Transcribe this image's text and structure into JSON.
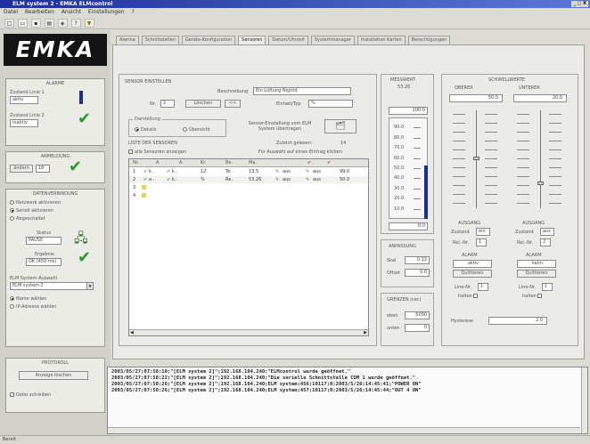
{
  "window": {
    "title": "ELM system 2 - EMKA ELMcontrol",
    "controls": "_ □ X"
  },
  "menu": [
    "Datei",
    "Bearbeiten",
    "Ansicht",
    "Einstellungen",
    "?"
  ],
  "logo": "EMKA",
  "alarme": {
    "title": "ALARME",
    "line1_label": "Zustand Linie 1",
    "line1_value": "aktiv",
    "line2_label": "Zustand Linie 2",
    "line2_value": "inaktiv"
  },
  "anmeldung": {
    "title": "ANMELDUNG",
    "button": "ändern",
    "value": "18"
  },
  "datenverbindung": {
    "title": "DATENVERBINDUNG",
    "options": [
      "Netzwerk aktivieren",
      "Seriell aktivieren",
      "Abgeschaltet"
    ],
    "status_label": "Status",
    "status_value": "PAUSE",
    "ergebnis_label": "Ergebnis",
    "ergebnis_value": "OK (450 ms)",
    "system_label": "ELM System-Auswahl",
    "system_value": "ELM system 2",
    "mode_options": [
      "Name wählen",
      "IP-Adresse wählen"
    ]
  },
  "protokoll": {
    "title": "PROTOKOLL",
    "button": "Anzeige löschen",
    "checkbox": "Datei schreiben"
  },
  "tabs": [
    "Alarme",
    "Schnittstellen",
    "Geräte-Konfiguration",
    "Sensoren",
    "Datum/Uhrzeit",
    "Systemmanager",
    "Installation Karten",
    "Berechtigungen"
  ],
  "sensor": {
    "title": "SENSOR EINSTELLEN",
    "beschreibung_label": "Beschreibung",
    "beschreibung_value": "Ein Lüftung Nightd",
    "nr_label": "Nr.",
    "nr_value": "2",
    "btn_up": "Löschen",
    "btn_down": "<<",
    "einheit_label": "Einheit/Typ",
    "einheit_value": "%",
    "darstellung_label": "Darstellung",
    "darstellung_options": [
      "Details",
      "Übersicht"
    ],
    "sensor_btn_text": "Sensor-Einstellung vom ELM System übertragen",
    "zuletzt_label": "Zuletzt gelesen:",
    "zuletzt_value": "14",
    "liste_label": "LISTE DER SENSOREN",
    "alle_sensoren": "alle Sensoren anzeigen",
    "auswahl_hint": "Für Auswahl auf einen Eintrag klicken",
    "columns": [
      "Nr.",
      "A",
      "A",
      "Kr.",
      "Be.",
      "Ma.",
      "",
      ""
    ],
    "rows": [
      {
        "nr": "1",
        "c1": "k..",
        "c2": "k..",
        "val": "12",
        "unit": "Te..",
        "v1": "13.5",
        "a": "aus",
        "b": "aus",
        "x": "99.0"
      },
      {
        "nr": "2",
        "c1": "a..",
        "c2": "k..",
        "val": "%",
        "unit": "Re..",
        "v1": "53.26",
        "a": "aus",
        "b": "aus",
        "x": "50.0"
      },
      {
        "nr": "3",
        "c1": "",
        "c2": "",
        "val": "",
        "unit": "",
        "v1": "",
        "a": "",
        "b": "",
        "x": ""
      },
      {
        "nr": "4",
        "c1": "",
        "c2": "",
        "val": "",
        "unit": "",
        "v1": "",
        "a": "",
        "b": "",
        "x": ""
      }
    ]
  },
  "messwert": {
    "title": "MESSWERT",
    "value": "53.26",
    "top": "100.0",
    "scale": [
      "90.0",
      "80.0",
      "70.0",
      "60.0",
      "50.0",
      "40.0",
      "30.0",
      "20.0",
      "10.0"
    ],
    "bottom": "0.0",
    "fill_fraction": 0.53
  },
  "anpassung": {
    "title": "ANPASSUNG",
    "skal_label": "Skal",
    "skal_value": "0.12",
    "offset_label": "Offset",
    "offset_value": "0.0"
  },
  "grenzen": {
    "title": "GRENZEN (sec)",
    "oben_label": "oben",
    "oben_value": "5000",
    "unten_label": "unten",
    "unten_value": "0"
  },
  "schwellwerte": {
    "title": "SCHWELLWERTE",
    "oberer_label": "OBERER",
    "oberer_value": "50.0",
    "unterer_label": "UNTERER",
    "unterer_value": "20.0",
    "ausgang_label": "AUSGANG",
    "zustand_label": "Zustand",
    "zustand_left": "ein",
    "zustand_right": "aus",
    "relnr_label": "Rel.-Nr.",
    "relnr_left": "1",
    "relnr_right": "2",
    "alarm_label": "ALARM",
    "alarm_left": "aktiv",
    "alarm_right": "keim",
    "alarm_btn": "Quittieren",
    "linenr_label": "Line-Nr.",
    "linenr_left": "1",
    "linenr_right": "1",
    "halten_label": "halten",
    "hysterese_label": "Hysterese",
    "hysterese_value": "2.0"
  },
  "log": [
    "2003/05/27;07:58:10;\"[ELM system 2]\";192.168.104.240;\"ELMcontrol wurde geöffnet.\"",
    "2003/05/27;07:58:22;\"[ELM system 2]\";192.168.104.240;\"Die serielle Schnittstelle COM 1 wurde geöffnet.\"",
    "2003/05/27;07:58:26;\"[ELM system 2]\";192.168.104.240;ELM system;456;10117;0;2003/5/26;14:45:41;\"POWER ON\"",
    "2003/05/27;07:58:26;\"[ELM system 2]\";192.168.104.240;ELM system;457;10117;0;2003/5/26;14:45:44;\"OUT 4 ON\""
  ],
  "status": "Bereit"
}
